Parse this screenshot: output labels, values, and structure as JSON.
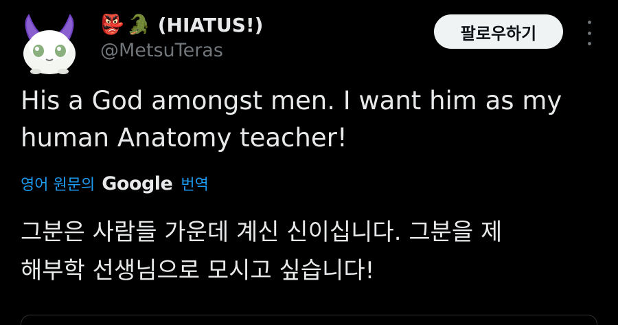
{
  "author": {
    "emoji_badges": [
      "👺",
      "🐊"
    ],
    "display_name": "(HIATUS!)",
    "handle": "@MetsuTeras"
  },
  "actions": {
    "follow_label": "팔로우하기",
    "more_icon": "more-dots-icon"
  },
  "tweet": {
    "text_line1": "His a God amongst men. I want him as my",
    "text_line2": "human Anatomy teacher!"
  },
  "translation": {
    "prefix": "영어 원문의",
    "brand": "Google",
    "suffix": "번역",
    "text_line1": "그분은 사람들 가운데 계신 신이십니다. 그분을 제",
    "text_line2": "해부학 선생님으로 모시고 싶습니다!"
  },
  "colors": {
    "background": "#000000",
    "text": "#e7e9ea",
    "muted": "#71767b",
    "link": "#1d9bf0",
    "button_bg": "#eff3f4"
  }
}
